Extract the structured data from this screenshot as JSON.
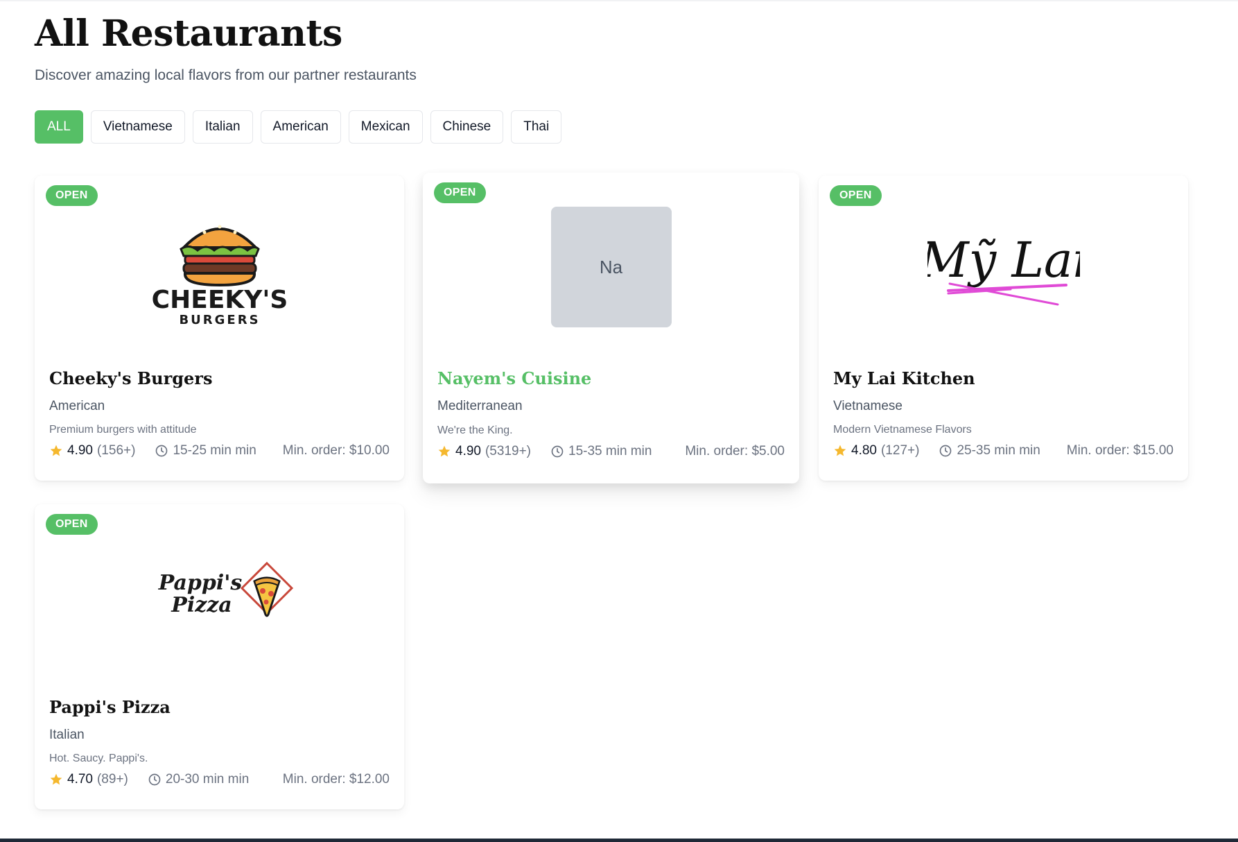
{
  "header": {
    "title": "All Restaurants",
    "subtitle": "Discover amazing local flavors from our partner restaurants"
  },
  "filters": [
    "ALL",
    "Vietnamese",
    "Italian",
    "American",
    "Mexican",
    "Chinese",
    "Thai"
  ],
  "active_filter": "ALL",
  "colors": {
    "accent": "#56bf66",
    "star": "#f5b82e",
    "placeholder": "#d1d5db"
  },
  "restaurants": [
    {
      "status": "OPEN",
      "name": "Cheeky's Burgers",
      "cuisine": "American",
      "description": "Premium burgers with attitude",
      "rating": "4.90",
      "reviews": "(156+)",
      "time": "15-25 min min",
      "min_order": "Min. order: $10.00",
      "logo": {
        "type": "burger-logo",
        "line1": "CHEEKY'S",
        "line2": "BURGERS"
      }
    },
    {
      "status": "OPEN",
      "name": "Nayem's Cuisine",
      "cuisine": "Mediterranean",
      "description": "We're the King.",
      "rating": "4.90",
      "reviews": "(5319+)",
      "time": "15-35 min min",
      "min_order": "Min. order: $5.00",
      "logo": {
        "type": "placeholder",
        "initials": "Na"
      }
    },
    {
      "status": "OPEN",
      "name": "My Lai Kitchen",
      "cuisine": "Vietnamese",
      "description": "Modern Vietnamese Flavors",
      "rating": "4.80",
      "reviews": "(127+)",
      "time": "25-35 min min",
      "min_order": "Min. order: $15.00",
      "logo": {
        "type": "script-logo",
        "text": "Mỹ Lai"
      }
    },
    {
      "status": "OPEN",
      "name": "Pappi's Pizza",
      "cuisine": "Italian",
      "description": "Hot. Saucy. Pappi's.",
      "rating": "4.70",
      "reviews": "(89+)",
      "time": "20-30 min min",
      "min_order": "Min. order: $12.00",
      "logo": {
        "type": "pizza-logo",
        "line1": "Pappi's",
        "line2": "Pizza"
      }
    }
  ]
}
